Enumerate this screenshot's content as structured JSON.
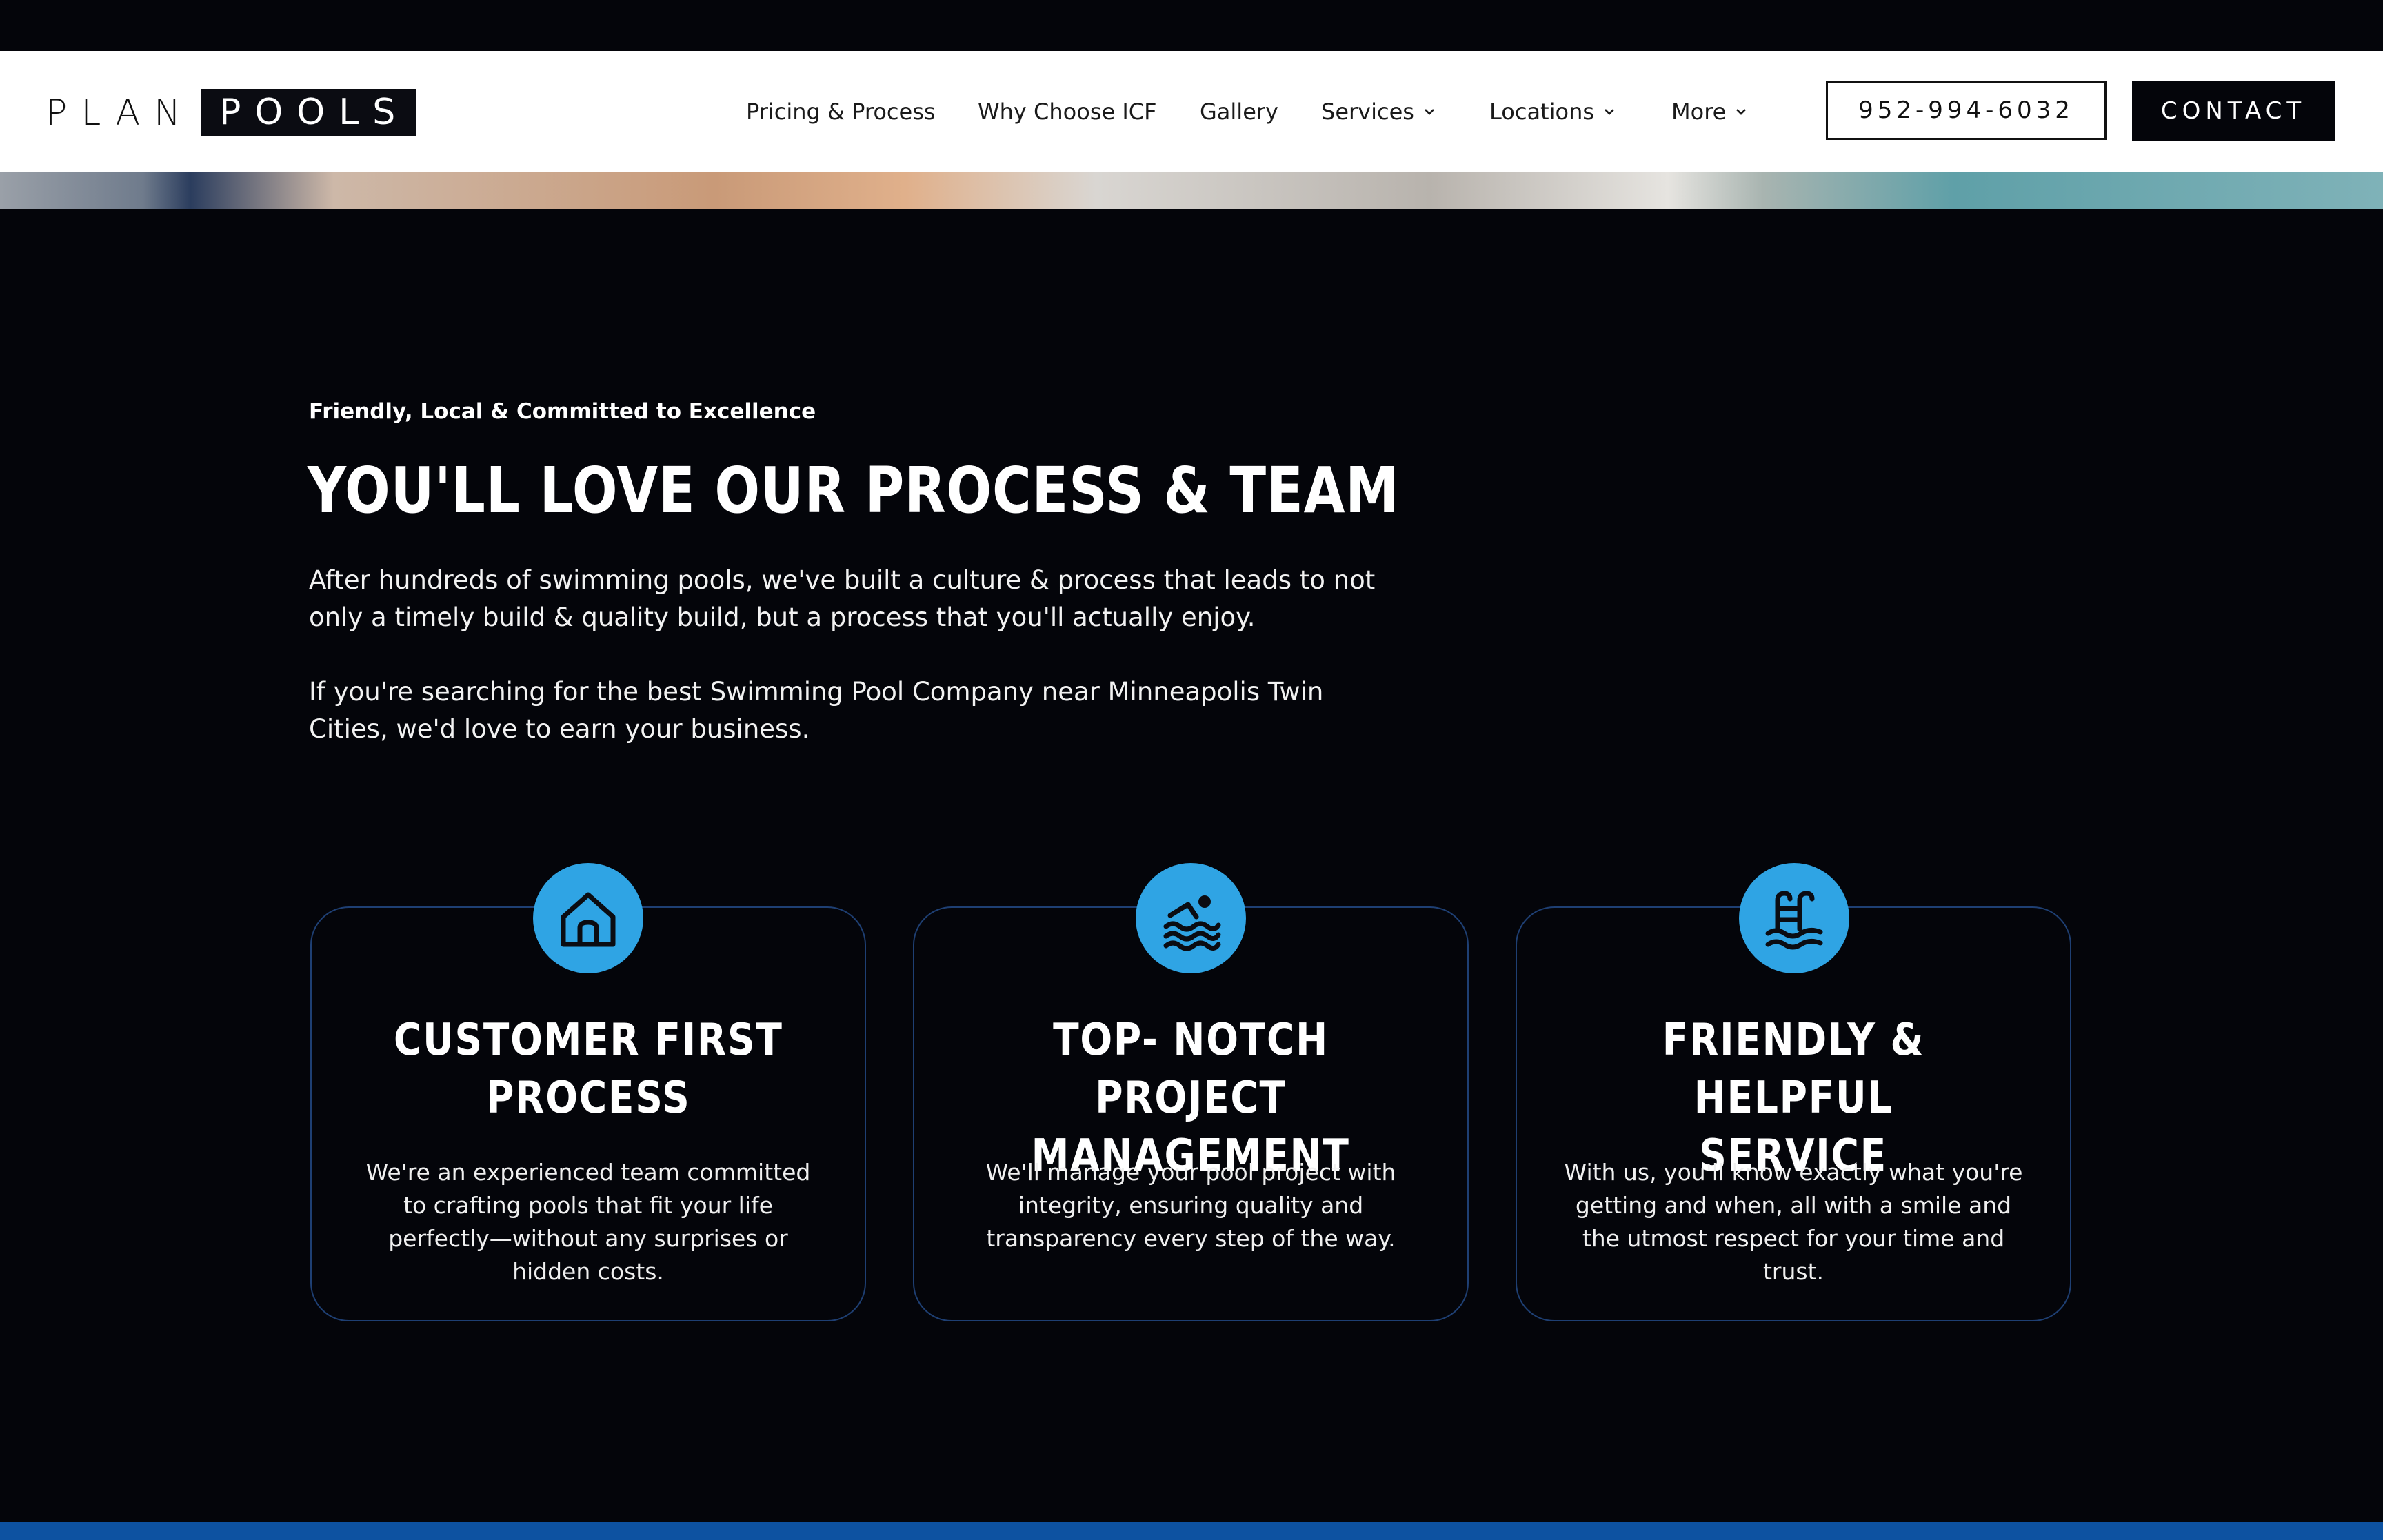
{
  "header": {
    "logo": {
      "left": "PLAN",
      "right": "POOLS"
    },
    "nav": [
      {
        "label": "Pricing & Process",
        "dropdown": false
      },
      {
        "label": "Why Choose ICF",
        "dropdown": false
      },
      {
        "label": "Gallery",
        "dropdown": false
      },
      {
        "label": "Services",
        "dropdown": true
      },
      {
        "label": "Locations",
        "dropdown": true
      },
      {
        "label": "More",
        "dropdown": true
      }
    ],
    "phone": "952-994-6032",
    "contact_label": "CONTACT"
  },
  "section": {
    "eyebrow": "Friendly, Local & Committed to Excellence",
    "title": "YOU'LL LOVE OUR PROCESS & TEAM",
    "paragraph1": "After hundreds of swimming pools, we've built a culture & process that leads to not only a timely build & quality build, but a process that you'll actually enjoy.",
    "paragraph2": "If you're searching for the best Swimming Pool Company near Minneapolis Twin Cities, we'd love to earn your business."
  },
  "cards": [
    {
      "icon": "house-icon",
      "title_line1": "CUSTOMER FIRST",
      "title_line2": "PROCESS",
      "text": "We're an experienced team committed to crafting pools that fit your life perfectly—without any surprises or hidden costs."
    },
    {
      "icon": "swimmer-icon",
      "title_line1": "TOP- NOTCH PROJECT",
      "title_line2": "MANAGEMENT",
      "text": "We'll manage your pool project with integrity, ensuring quality and transparency every step of the way."
    },
    {
      "icon": "pool-ladder-icon",
      "title_line1": "FRIENDLY & HELPFUL",
      "title_line2": "SERVICE",
      "text": "With us, you'll know exactly what you're getting and when, all with a smile and the utmost respect for your time and trust."
    }
  ],
  "colors": {
    "background": "#04050a",
    "accent_blue": "#2fa4e4",
    "card_border": "#1e3f73",
    "footer_bar": "#0d52a1"
  }
}
